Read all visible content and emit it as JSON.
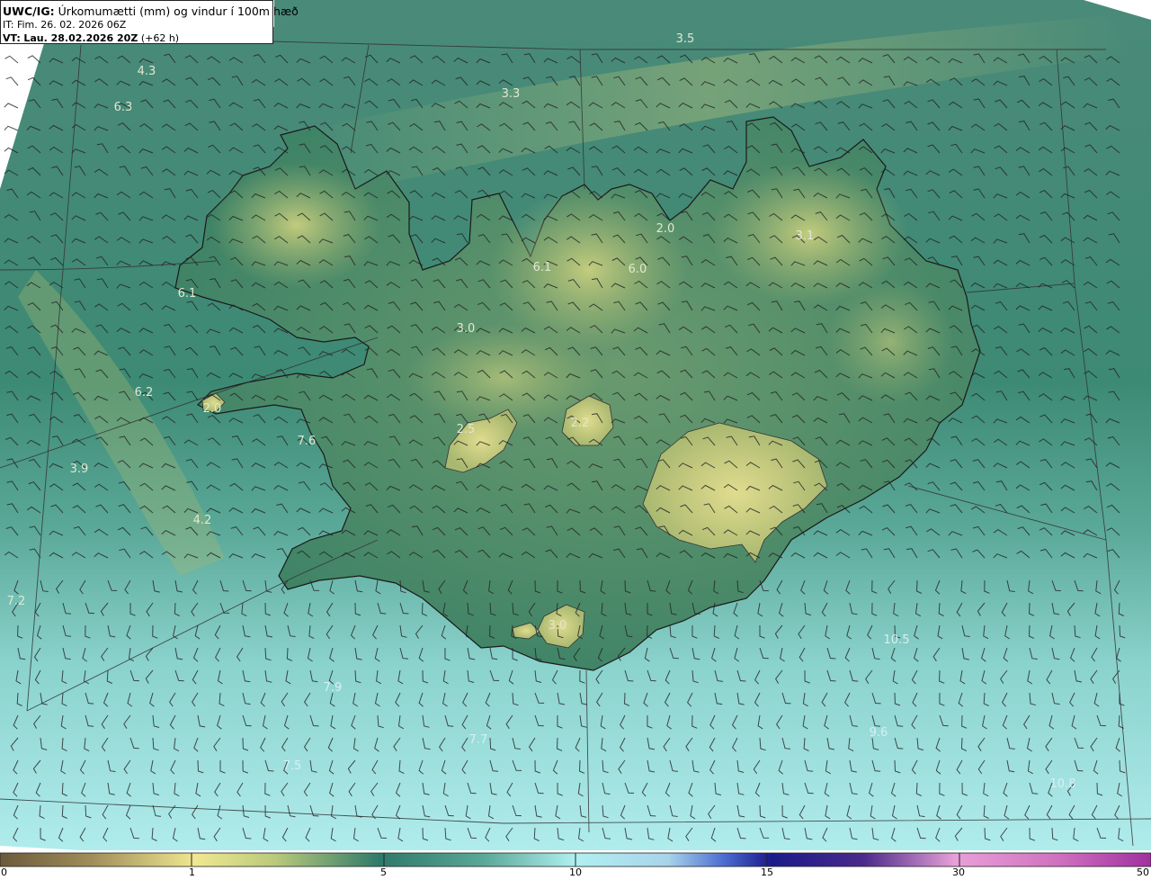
{
  "header": {
    "model": "UWC/IG:",
    "field": "Úrkomumætti (mm) og vindur í 100m hæð",
    "init_time": "IT: Fim. 26. 02. 2026 06Z",
    "valid_prefix": "VT:",
    "valid_time": "Lau. 28.02.2026 20Z",
    "lead": "(+62 h)"
  },
  "colorbar": {
    "labels": [
      "0",
      "1",
      "5",
      "10",
      "15",
      "30",
      "50"
    ],
    "colors": [
      "#6b5a3a",
      "#a08e5a",
      "#d9d28a",
      "#f0e890",
      "#b8c97a",
      "#3f8a6a",
      "#2e7a6a",
      "#4a9a8a",
      "#7ac6c0",
      "#a8eaea",
      "#c0f0f4",
      "#a8d4ea",
      "#5a7ad0",
      "#1a1a8a",
      "#2a1a7a",
      "#6a3aa0",
      "#b070c0",
      "#e8a0d8",
      "#d070c0",
      "#a030a0"
    ]
  },
  "map": {
    "colors": {
      "ocean_north": "#4a8a78",
      "ocean_south": "#a8e4e2",
      "land_low": "#3d8266",
      "land_high": "#c9d07e",
      "coast": "#1a1a1a",
      "grid": "#333333"
    },
    "labels": [
      {
        "text": "3.5",
        "color": "#e0e8d0"
      },
      {
        "text": "4.3",
        "color": "#e0e8d0"
      },
      {
        "text": "3.3",
        "color": "#e0e8d0"
      },
      {
        "text": "6.3",
        "color": "#e0e8d0"
      },
      {
        "text": "2.0",
        "color": "#e0e8d0"
      },
      {
        "text": "3.1",
        "color": "#e0e8d0"
      },
      {
        "text": "6.1",
        "color": "#e0e8d0"
      },
      {
        "text": "6.0",
        "color": "#e0e8d0"
      },
      {
        "text": "6.1",
        "color": "#e0e8d0"
      },
      {
        "text": "3.0",
        "color": "#e0e8d0"
      },
      {
        "text": "6.2",
        "color": "#e0e8d0"
      },
      {
        "text": "2.0",
        "color": "#e0e8d0"
      },
      {
        "text": "2.5",
        "color": "#e0e8d0"
      },
      {
        "text": "2.2",
        "color": "#e0e8d0"
      },
      {
        "text": "7.6",
        "color": "#e0e8d0"
      },
      {
        "text": "3.9",
        "color": "#e0e8d0"
      },
      {
        "text": "4.2",
        "color": "#e0e8d0"
      },
      {
        "text": "7.2",
        "color": "#e0e8d0"
      },
      {
        "text": "3.0",
        "color": "#e0e8d0"
      },
      {
        "text": "10.5",
        "color": "#d8f0f0"
      },
      {
        "text": "9.6",
        "color": "#d8f0f0"
      },
      {
        "text": "7.9",
        "color": "#d8f0f0"
      },
      {
        "text": "7.7",
        "color": "#d8f0f0"
      },
      {
        "text": "7.5",
        "color": "#d8f0f0"
      },
      {
        "text": "10.8",
        "color": "#d8f0f0"
      }
    ]
  }
}
